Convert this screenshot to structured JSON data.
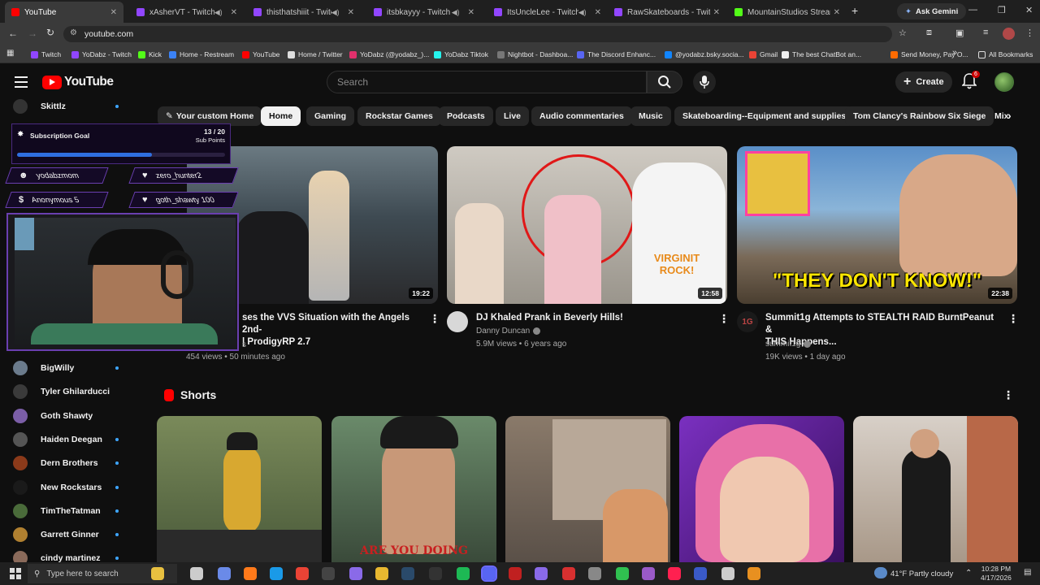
{
  "browser": {
    "tabs": [
      {
        "title": "YouTube",
        "color": "#ff0000"
      },
      {
        "title": "xAsherVT - Twitch",
        "color": "#9146ff"
      },
      {
        "title": "thisthatshiiit - Twitch",
        "color": "#9146ff"
      },
      {
        "title": "itsbkayyy - Twitch",
        "color": "#9146ff"
      },
      {
        "title": "ItsUncleLee - Twitch",
        "color": "#9146ff"
      },
      {
        "title": "RawSkateboards - Twitch",
        "color": "#9146ff"
      },
      {
        "title": "MountainStudios Stream - V",
        "color": "#53fc18"
      }
    ],
    "new_tab": "+",
    "ask_gemini": "Ask Gemini",
    "url": "youtube.com",
    "bookmarks": [
      {
        "label": "Twitch",
        "color": "#9146ff"
      },
      {
        "label": "YoDabz - Twitch",
        "color": "#9146ff"
      },
      {
        "label": "Kick",
        "color": "#53fc18"
      },
      {
        "label": "Home - Restream",
        "color": "#3b82f6"
      },
      {
        "label": "YouTube",
        "color": "#ff0000"
      },
      {
        "label": "Home / Twitter",
        "color": "#dddddd"
      },
      {
        "label": "YoDabz (@yodabz_)...",
        "color": "#e1306c"
      },
      {
        "label": "YoDabz Tiktok",
        "color": "#25f4ee"
      },
      {
        "label": "Nightbot - Dashboa...",
        "color": "#777777"
      },
      {
        "label": "The Discord Enhanc...",
        "color": "#5865f2"
      },
      {
        "label": "@yodabz.bsky.socia...",
        "color": "#1185fe"
      },
      {
        "label": "Gmail",
        "color": "#ea4335"
      },
      {
        "label": "The best ChatBot an...",
        "color": "#eeeeee"
      },
      {
        "label": "Send Money, Pay O...",
        "color": "#ff6b00"
      }
    ],
    "more_bookmarks": "»",
    "all_bookmarks": "All Bookmarks"
  },
  "youtube": {
    "logo": "YouTube",
    "search_placeholder": "Search",
    "create_label": "Create",
    "notif_count": "6",
    "chips": [
      "Your custom Home",
      "Home",
      "Gaming",
      "Rockstar Games",
      "Podcasts",
      "Live",
      "Audio commentaries",
      "Music",
      "Skateboarding--Equipment and supplies",
      "Tom Clancy's Rainbow Six Siege",
      "Mix"
    ],
    "videos": [
      {
        "title_line1": "ses the VVS Situation with the Angels 2nd-",
        "title_line2": "| ProdigyRP 2.7",
        "channel": "s",
        "stats": "454 views • 50 minutes ago",
        "duration": "19:22"
      },
      {
        "title_line1": "DJ Khaled Prank in Beverly Hills!",
        "title_line2": "",
        "channel": "Danny Duncan",
        "stats": "5.9M views • 6 years ago",
        "duration": "12:58",
        "thumb_text1": "VIRGINIT",
        "thumb_text2": "ROCK!"
      },
      {
        "title_line1": "Summit1g Attempts to STEALTH RAID BurntPeanut &",
        "title_line2": "THIS Happens...",
        "channel": "summit1g",
        "stats": "19K views • 1 day ago",
        "duration": "22:38",
        "thumb_text": "\"THEY DON'T KNOW!\""
      }
    ],
    "shorts_title": "Shorts",
    "shorts_caption": "ARE YOU DOING"
  },
  "sidebar": {
    "top_item": "Skittlz",
    "items": [
      "BigWilly",
      "Tyler Ghilarducci",
      "Goth Shawty",
      "Haiden Deegan",
      "Dern Brothers",
      "New Rockstars",
      "TimTheTatman",
      "Garrett Ginner",
      "cindy martinez"
    ],
    "item_colors": [
      "#6b7b8c",
      "#3a3a3a",
      "#7b5ea7",
      "#555555",
      "#8b3a1a",
      "#1a1a1a",
      "#4a6b3a",
      "#b08030",
      "#8a6a5a"
    ]
  },
  "overlay": {
    "goal_title": "Subscription Goal",
    "goal_count": "13 / 20",
    "goal_unit": "Sub Points",
    "goal_progress": 0.65,
    "alerts": [
      {
        "name": "yodabzmom",
        "icon": "person-icon"
      },
      {
        "name": "zero_hunter2",
        "icon": "heart-icon"
      },
      {
        "name": "Anonymous 5",
        "icon": "dollar-icon"
      },
      {
        "name": "goth_shawty 100",
        "icon": "heart-icon"
      }
    ]
  },
  "taskbar": {
    "search_placeholder": "Type here to search",
    "weather": "41°F  Partly cloudy",
    "time": "10:28 PM",
    "date": "4/17/2026"
  }
}
